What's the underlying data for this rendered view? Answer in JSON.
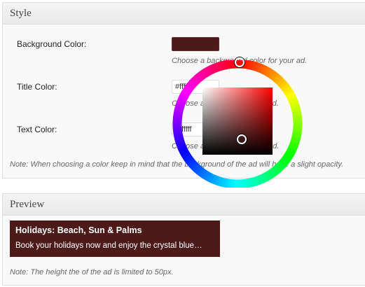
{
  "style_section": {
    "title": "Style",
    "fields": {
      "background_color": {
        "label": "Background Color:",
        "value": "#4d1a1a",
        "swatch_color": "#4d1a1a",
        "hint": "Choose a background color for your ad."
      },
      "title_color": {
        "label": "Title Color:",
        "value": "#ffffff",
        "hint": "Choose a title color for your ad."
      },
      "text_color": {
        "label": "Text Color:",
        "value": "#ffffff",
        "hint": "Choose a text color for your ad."
      }
    },
    "note": "Note: When choosing a color keep in mind that the background of the ad will have a slight opacity."
  },
  "color_picker": {
    "hue_color": "#ff0000",
    "colors": [
      "#ff0000",
      "#ffff00",
      "#00ff00",
      "#00ffff",
      "#0000ff",
      "#ff00ff"
    ]
  },
  "preview_section": {
    "title": "Preview",
    "ad": {
      "title": "Holidays: Beach, Sun & Palms",
      "text": "Book your holidays now and enjoy the crystal blue…",
      "background": "#4d1a1a",
      "text_color": "#ffffff"
    },
    "note": "Note: The height the of the ad is limited to 50px."
  }
}
